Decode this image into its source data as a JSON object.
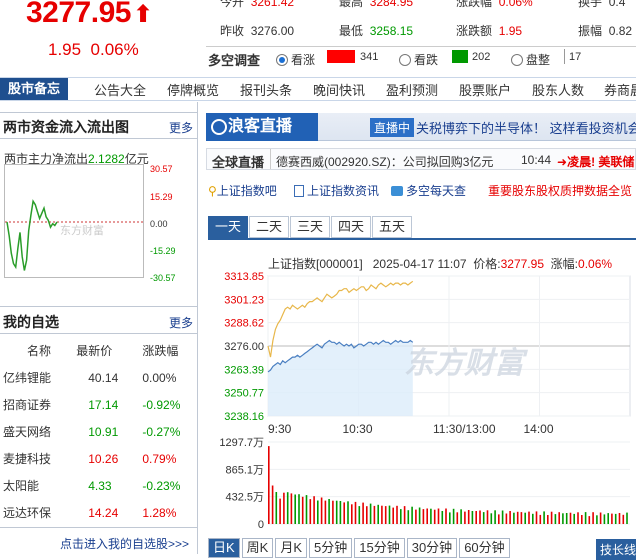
{
  "quote": {
    "price": "3277.95",
    "arrow": "⬆",
    "change": "1.95",
    "change_pct": "0.06%"
  },
  "stats": {
    "today_open": {
      "label": "今开",
      "value": "3261.42"
    },
    "high": {
      "label": "最高",
      "value": "3284.95"
    },
    "limit_up": {
      "label": "涨跌幅",
      "value": "0.06%"
    },
    "turnover": {
      "label": "换手",
      "value": "0.4"
    },
    "prev_close": {
      "label": "昨收",
      "value": "3276.00"
    },
    "low": {
      "label": "最低",
      "value": "3258.15"
    },
    "change_amt": {
      "label": "涨跌额",
      "value": "1.95"
    },
    "amplitude": {
      "label": "振幅",
      "value": "0.82"
    }
  },
  "survey": {
    "label": "多空调查",
    "bull": {
      "label": "看涨",
      "count": "341"
    },
    "bear": {
      "label": "看跌",
      "count": "202"
    },
    "flat": {
      "label": "盘整",
      "count": "17"
    }
  },
  "nav": {
    "head": "股市备忘",
    "items": [
      "公告大全",
      "停牌概览",
      "报刊头条",
      "晚间快讯",
      "盈利预测",
      "股票账户",
      "股东人数",
      "券商晨报"
    ]
  },
  "flow": {
    "title": "两市资金流入流出图",
    "more": "更多",
    "net_label": "两市主力净流出",
    "net_value": "2.1282",
    "net_unit": "亿元",
    "watermark": "东方财富",
    "y_ticks": [
      "30.57",
      "15.29",
      "0.00",
      "-15.29",
      "-30.57"
    ],
    "series": [
      0,
      -8,
      -18,
      -24,
      -26,
      -15,
      -6,
      -20,
      -28,
      -22,
      -5,
      4,
      12,
      10,
      6,
      2,
      5,
      8,
      3,
      1,
      -3,
      -1,
      -2,
      0
    ]
  },
  "watchlist": {
    "title": "我的自选",
    "more": "更多",
    "headers": [
      "名称",
      "最新价",
      "涨跌幅"
    ],
    "rows": [
      {
        "name": "亿纬锂能",
        "price": "40.14",
        "pct": "0.00%",
        "dir": "flat"
      },
      {
        "name": "招商证券",
        "price": "17.14",
        "pct": "-0.92%",
        "dir": "down"
      },
      {
        "name": "盛天网络",
        "price": "10.91",
        "pct": "-0.27%",
        "dir": "down"
      },
      {
        "name": "麦捷科技",
        "price": "10.26",
        "pct": "0.79%",
        "dir": "up"
      },
      {
        "name": "太阳能",
        "price": "4.33",
        "pct": "-0.23%",
        "dir": "down"
      },
      {
        "name": "远达环保",
        "price": "14.24",
        "pct": "1.28%",
        "dir": "up"
      }
    ],
    "footer": "点击进入我的自选股>>>"
  },
  "live": {
    "logo": "浪客直播",
    "tag": "直播中",
    "headline": "关税博弈下的半导体！ 这样看投资机会？"
  },
  "ticker": {
    "label": "全球直播",
    "text": "德赛西威(002920.SZ)：公司拟回购3亿元",
    "time": "10:44",
    "extra": "凌晨! 美联储"
  },
  "links": [
    {
      "icon": "search-icon",
      "label": "上证指数吧"
    },
    {
      "icon": "doc-icon",
      "label": "上证指数资讯"
    },
    {
      "icon": "chat-icon",
      "label": "多空每天查"
    },
    {
      "icon": "",
      "label": "重要股东股权质押数据全览"
    }
  ],
  "period_tabs": [
    "一天",
    "二天",
    "三天",
    "四天",
    "五天"
  ],
  "chart_info": {
    "name": "上证指数[000001]",
    "datetime": "2025-04-17 11:07",
    "price_label": "价格:",
    "price": "3277.95",
    "pct_label": "涨幅:",
    "pct": "0.06%",
    "watermark": "东方财富"
  },
  "chart_data": {
    "type": "line",
    "y_ticks": [
      "3313.85",
      "3301.23",
      "3288.62",
      "3276.00",
      "3263.39",
      "3250.77",
      "3238.16"
    ],
    "ylim": [
      3238.16,
      3313.85
    ],
    "prev_close": 3276.0,
    "x_ticks": [
      "9:30",
      "10:30",
      "11:30/13:00",
      "14:00"
    ],
    "series": [
      {
        "name": "上证指数",
        "color": "#e8b74a",
        "values": [
          3276,
          3270,
          3279,
          3285,
          3288,
          3290,
          3293,
          3296,
          3297,
          3296,
          3298,
          3297,
          3296,
          3297,
          3298,
          3297,
          3299,
          3300,
          3300,
          3301,
          3302,
          3301,
          3300,
          3302,
          3304,
          3303,
          3302,
          3303,
          3304,
          3306,
          3306,
          3307,
          3307,
          3305,
          3306,
          3307,
          3306,
          3307,
          3308,
          3308,
          3306,
          3307,
          3309,
          3308,
          3307,
          3309,
          3310,
          3309,
          3308,
          3309,
          3310,
          3309,
          3310,
          3310,
          3309,
          3310,
          3310,
          3309,
          3310,
          3311
        ]
      },
      {
        "name": "均价",
        "color": "#4a7fc1",
        "values": [
          3262,
          3263,
          3265,
          3266,
          3267,
          3266,
          3268,
          3267,
          3268,
          3269,
          3270,
          3270,
          3271,
          3270,
          3271,
          3272,
          3273,
          3274,
          3275,
          3276,
          3277,
          3276,
          3275,
          3277,
          3278,
          3279,
          3278,
          3278,
          3277,
          3278,
          3277,
          3276,
          3277,
          3276,
          3277,
          3275,
          3276,
          3277,
          3277,
          3276,
          3277,
          3278,
          3278,
          3277,
          3278,
          3277,
          3278,
          3279,
          3278,
          3278,
          3277,
          3278,
          3279,
          3278,
          3279,
          3278,
          3278,
          3278,
          3279,
          3278
        ]
      }
    ],
    "volume_ticks": [
      "1297.7万",
      "865.1万",
      "432.5万",
      "0"
    ]
  },
  "bottom_tabs": [
    "日K",
    "周K",
    "月K",
    "5分钟",
    "15分钟",
    "30分钟",
    "60分钟"
  ],
  "bottom_right": "技长线"
}
